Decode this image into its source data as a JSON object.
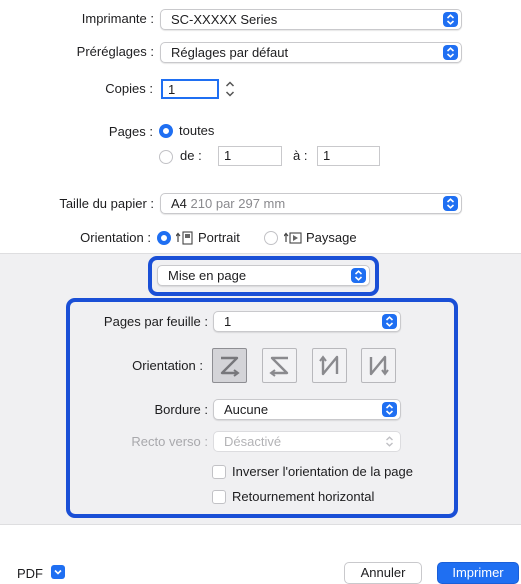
{
  "colors": {
    "accent": "#1f6ff2",
    "highlight": "#1a4fd6",
    "panel": "#f0f0f2"
  },
  "printer": {
    "label": "Imprimante :",
    "value": "SC-XXXXX Series"
  },
  "presets": {
    "label": "Préréglages :",
    "value": "Réglages par défaut"
  },
  "copies": {
    "label": "Copies :",
    "value": "1"
  },
  "pages": {
    "label": "Pages :",
    "all_label": "toutes",
    "from_label": "de :",
    "from_value": "1",
    "to_label": "à :",
    "to_value": "1"
  },
  "paper_size": {
    "label": "Taille du papier :",
    "value_main": "A4",
    "value_detail": "210 par 297 mm"
  },
  "orientation": {
    "label": "Orientation :",
    "portrait": "Portrait",
    "landscape": "Paysage"
  },
  "section": {
    "value": "Mise en page"
  },
  "layout": {
    "pages_per_sheet_label": "Pages par feuille :",
    "pages_per_sheet_value": "1",
    "direction_label": "Orientation :",
    "direction_icons": [
      "z-order-icon",
      "reverse-z-order-icon",
      "reverse-n-order-icon",
      "n-order-icon"
    ],
    "border_label": "Bordure :",
    "border_value": "Aucune",
    "duplex_label": "Recto verso :",
    "duplex_value": "Désactivé",
    "reverse_orientation_label": "Inverser l'orientation de la page",
    "flip_horizontal_label": "Retournement horizontal"
  },
  "footer": {
    "pdf_label": "PDF",
    "cancel_label": "Annuler",
    "print_label": "Imprimer"
  }
}
